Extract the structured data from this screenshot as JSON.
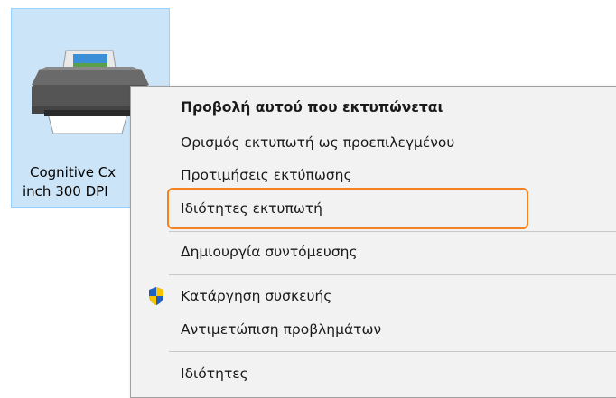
{
  "desktop": {
    "printer": {
      "icon": "printer-icon",
      "label_line1": "Cognitive Cx",
      "label_line2": "inch 300 DPI"
    }
  },
  "context_menu": {
    "items": [
      {
        "label": "Προβολή αυτού που εκτυπώνεται",
        "bold": true
      },
      {
        "label": "Ορισμός εκτυπωτή ως προεπιλεγμένου"
      },
      {
        "label": "Προτιμήσεις εκτύπωσης"
      },
      {
        "label": "Ιδιότητες εκτυπωτή",
        "highlighted": true
      },
      {
        "label": "Δημιουργία συντόμευσης"
      },
      {
        "label": "Κατάργηση συσκευής",
        "icon": "uac-shield-icon"
      },
      {
        "label": "Αντιμετώπιση προβλημάτων"
      },
      {
        "label": "Ιδιότητες"
      }
    ]
  },
  "colors": {
    "selection_bg": "#cce4f7",
    "menu_bg": "#f2f2f2",
    "highlight_outline": "#f58220",
    "shield_blue": "#1f5fbf",
    "shield_yellow": "#f6c400"
  }
}
